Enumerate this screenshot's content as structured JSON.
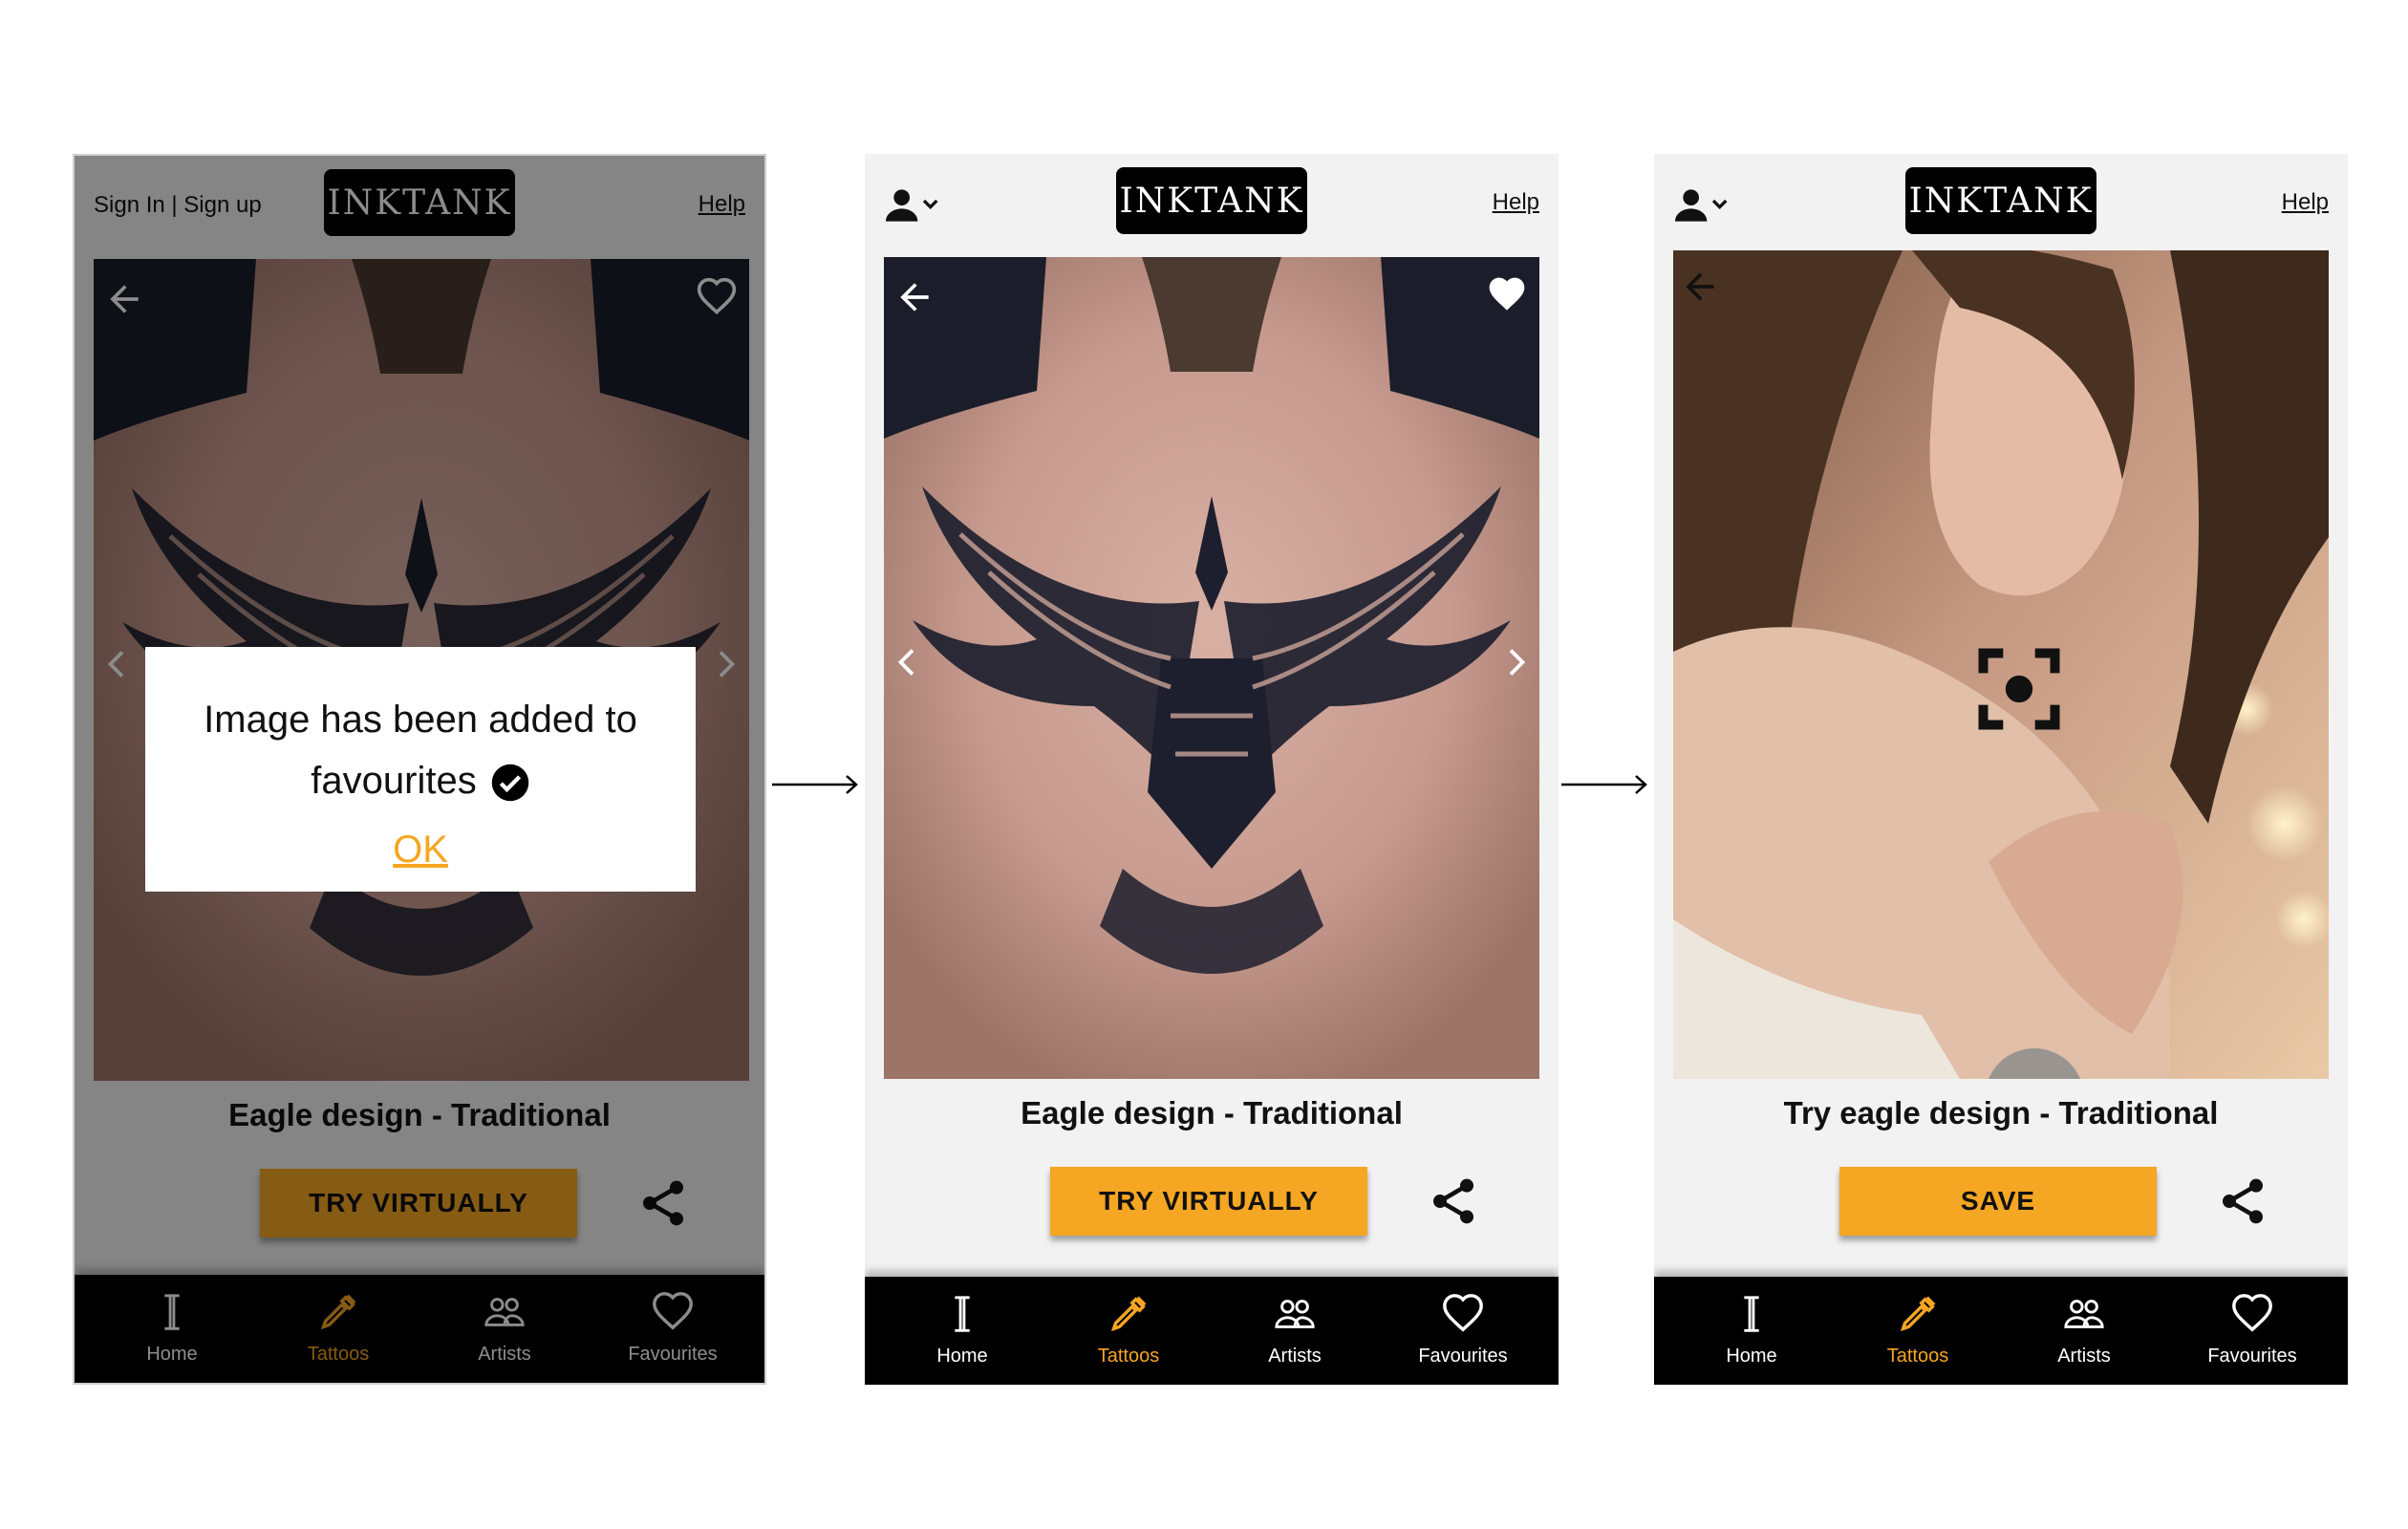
{
  "app": {
    "logo": "INKTANK",
    "help": "Help",
    "signin": "Sign In | Sign up"
  },
  "screen1": {
    "title": "Eagle design - Traditional",
    "cta": "TRY VIRTUALLY",
    "dialog": {
      "line1": "Image has been added to",
      "line2": "favourites",
      "ok": "OK"
    }
  },
  "screen2": {
    "title": "Eagle design - Traditional",
    "cta": "TRY VIRTUALLY"
  },
  "screen3": {
    "title": "Try eagle design - Traditional",
    "cta": "SAVE"
  },
  "nav": {
    "home": "Home",
    "tattoos": "Tattoos",
    "artists": "Artists",
    "favourites": "Favourites"
  },
  "colors": {
    "accent": "#f5a623",
    "bar": "#000000",
    "background": "#f2f2f2"
  },
  "icons": [
    "back-arrow-icon",
    "heart-icon",
    "chevron-icon",
    "share-icon",
    "user-icon",
    "home-icon",
    "tattoo-pen-icon",
    "artists-icon",
    "camera-icon",
    "focus-icon",
    "check-circle-icon"
  ]
}
